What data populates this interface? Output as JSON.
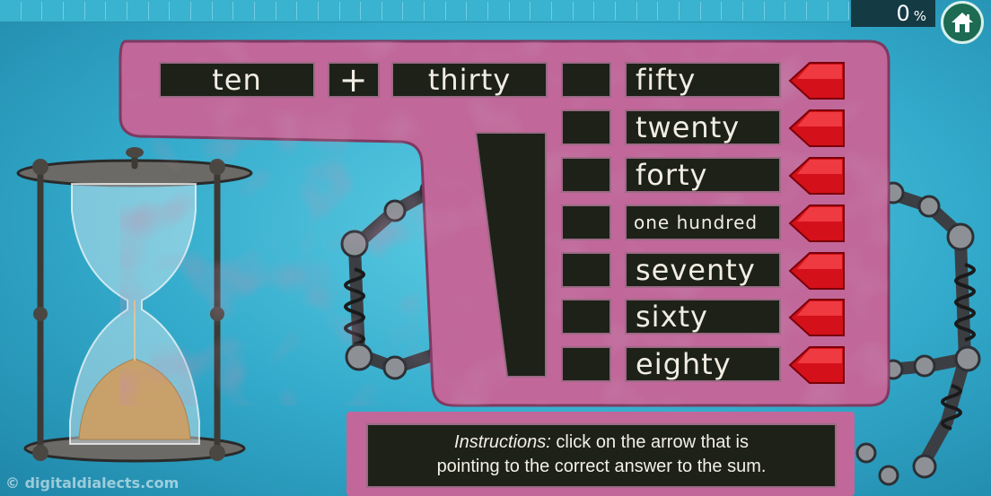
{
  "progress": {
    "value_percent": 0,
    "number": "0",
    "unit": "%"
  },
  "home_icon": "home-icon",
  "sum": {
    "left": "ten",
    "operator": "+",
    "right": "thirty"
  },
  "answers": [
    {
      "label": "fifty"
    },
    {
      "label": "twenty"
    },
    {
      "label": "forty"
    },
    {
      "label": "one hundred"
    },
    {
      "label": "seventy"
    },
    {
      "label": "sixty"
    },
    {
      "label": "eighty"
    }
  ],
  "instructions": {
    "prefix": "Instructions:",
    "line1": " click on the arrow that is",
    "line2": "pointing to the correct answer to the sum."
  },
  "copyright": "© digitaldialects.com",
  "colors": {
    "panel": "#c1679a",
    "cell": "#1d2118",
    "arrow": "#d4101a",
    "progress_fill": "#2a9c3f"
  }
}
